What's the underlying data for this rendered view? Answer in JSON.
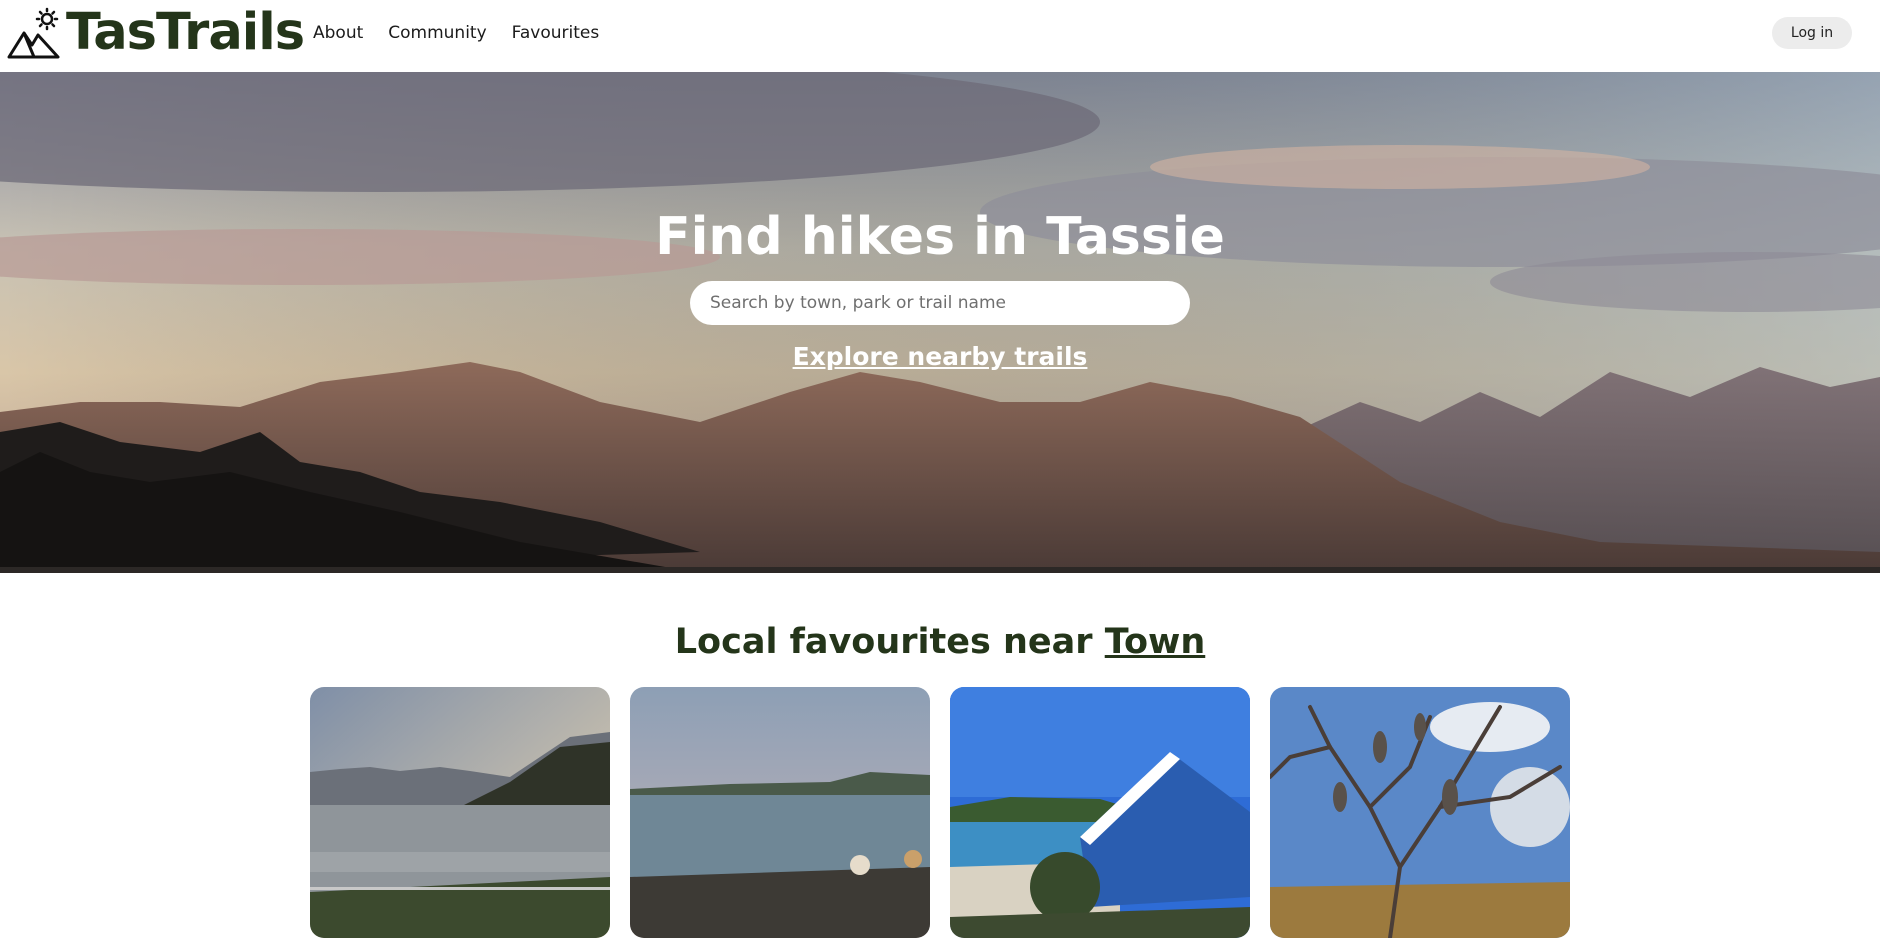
{
  "header": {
    "brand": "TasTrails",
    "nav": [
      "About",
      "Community",
      "Favourites"
    ],
    "login_label": "Log in"
  },
  "hero": {
    "title": "Find hikes in Tassie",
    "search_placeholder": "Search by town, park or trail name",
    "explore_link": "Explore nearby trails"
  },
  "favourites": {
    "title_prefix": "Local favourites near ",
    "town_link": "Town",
    "cards": [
      {
        "image": "lake-sunset-mountains"
      },
      {
        "image": "rocky-beach-bay"
      },
      {
        "image": "blue-boatshed-beach"
      },
      {
        "image": "banksia-tree-sky"
      }
    ]
  },
  "icons": {
    "logo": "mountain-sun-icon"
  },
  "colors": {
    "brand": "#24351a",
    "login_bg": "#ececec"
  }
}
